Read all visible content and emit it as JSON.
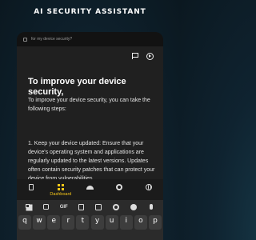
{
  "header": {
    "headline": "AI SECURITY ASSISTANT"
  },
  "app": {
    "topbar_text": "for my device security?",
    "card": {
      "title": "To improve your device security,",
      "intro": "To improve your device security, you can take the following steps:",
      "step1": "1. Keep your device updated: Ensure that your device's operating system and applications are regularly updated to the latest versions. Updates often contain security patches that can protect your device from vulnerabilities."
    },
    "tabs": [
      {
        "icon": "document-icon",
        "label": ""
      },
      {
        "icon": "dashboard-icon",
        "label": "Dashboard",
        "active": true
      },
      {
        "icon": "android-icon",
        "label": ""
      },
      {
        "icon": "gear-icon",
        "label": ""
      },
      {
        "icon": "globe-icon",
        "label": ""
      }
    ],
    "active_color": "#f5c518"
  },
  "keyboard": {
    "toolbar": [
      "apps-grid-icon",
      "sticker-icon",
      "GIF",
      "clipboard-icon",
      "translate-icon",
      "settings-icon",
      "palette-icon",
      "microphone-icon"
    ],
    "gif_label": "GIF",
    "row1": [
      "q",
      "w",
      "e",
      "r",
      "t",
      "y",
      "u",
      "i",
      "o",
      "p"
    ]
  }
}
